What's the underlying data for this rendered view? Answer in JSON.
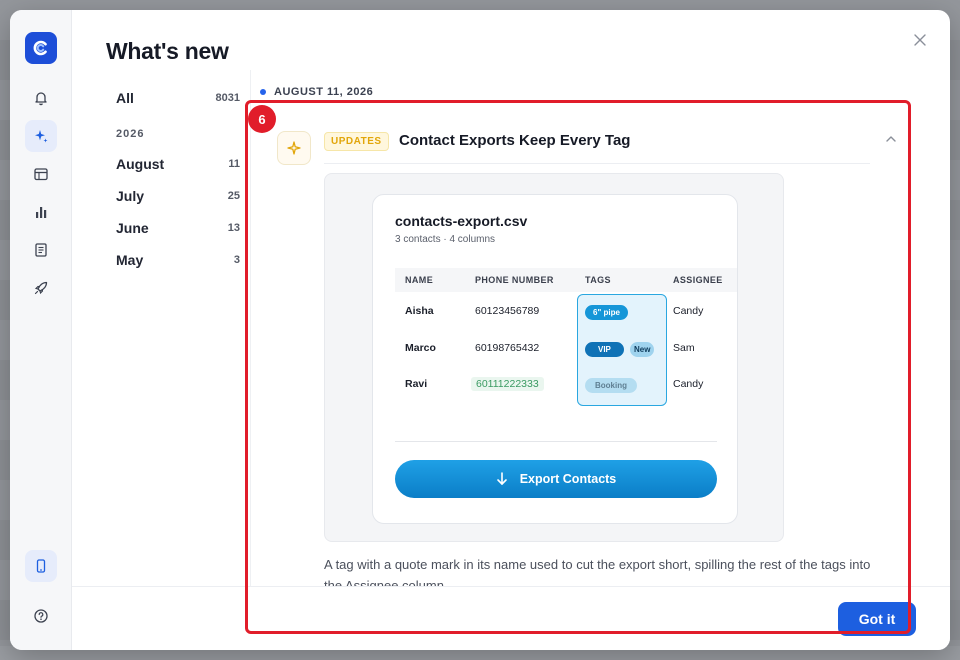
{
  "modal": {
    "title": "What's new"
  },
  "filters": {
    "all": {
      "label": "All",
      "count": "8031"
    },
    "year": "2026",
    "months": [
      {
        "label": "August",
        "count": "11"
      },
      {
        "label": "July",
        "count": "25"
      },
      {
        "label": "June",
        "count": "13"
      },
      {
        "label": "May",
        "count": "3"
      }
    ]
  },
  "entry": {
    "date": "AUGUST 11, 2026",
    "step": "6",
    "category": "UPDATES",
    "title": "Contact Exports Keep Every Tag",
    "description": "A tag with a quote mark in its name used to cut the export short, spilling the rest of the tags into the Assignee column."
  },
  "preview": {
    "file_name": "contacts-export.csv",
    "file_meta": "3 contacts · 4 columns",
    "columns": [
      "NAME",
      "PHONE NUMBER",
      "TAGS",
      "ASSIGNEE"
    ],
    "rows": [
      {
        "name": "Aisha",
        "phone": "60123456789",
        "tags": [
          "6\" pipe"
        ],
        "assignee": "Candy"
      },
      {
        "name": "Marco",
        "phone": "60198765432",
        "tags": [
          "VIP",
          "New"
        ],
        "assignee": "Sam"
      },
      {
        "name": "Ravi",
        "phone": "60111222333",
        "tags": [
          "Booking"
        ],
        "assignee": "Candy"
      }
    ],
    "export_button": "Export Contacts"
  },
  "footer": {
    "got_it": "Got it"
  },
  "colors": {
    "accent": "#1d5fe0",
    "highlight": "#e11d2a",
    "updates_tag": "#e2a60a",
    "tag_blue": "#1596d8"
  },
  "icons": [
    "app-logo-icon",
    "bell-icon",
    "sparkle-icon",
    "calendar-icon",
    "bar-chart-icon",
    "document-icon",
    "rocket-icon",
    "phone-icon",
    "help-icon",
    "close-icon",
    "chevron-up-icon",
    "arrow-down-icon"
  ]
}
